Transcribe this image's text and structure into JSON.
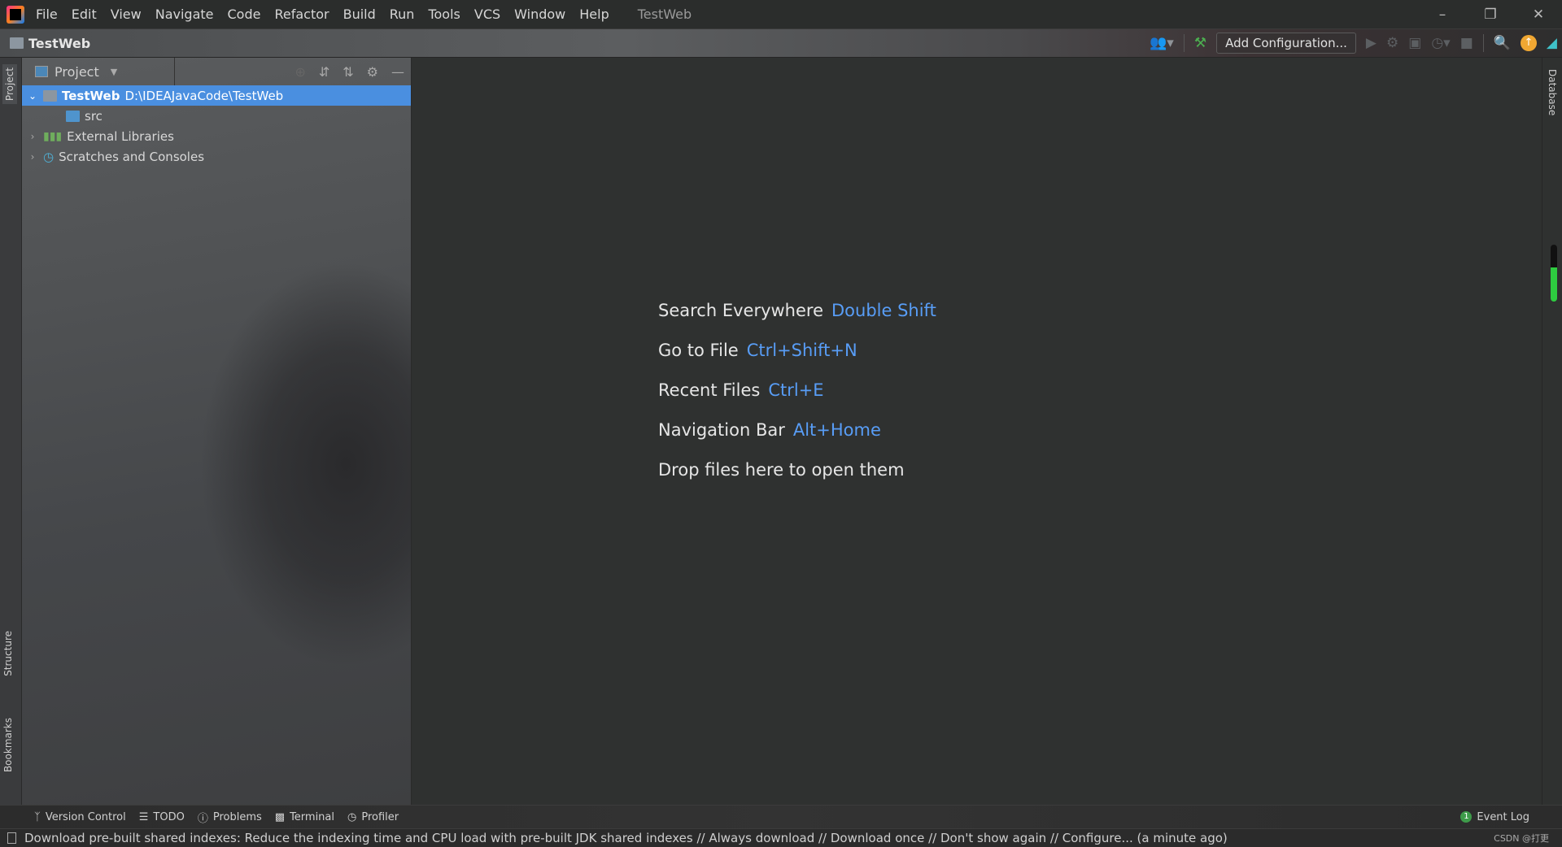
{
  "menubar": {
    "items": [
      "File",
      "Edit",
      "View",
      "Navigate",
      "Code",
      "Refactor",
      "Build",
      "Run",
      "Tools",
      "VCS",
      "Window",
      "Help"
    ],
    "title": "TestWeb"
  },
  "navbar": {
    "project": "TestWeb",
    "add_configuration": "Add Configuration..."
  },
  "left_stripe": {
    "project": "Project",
    "structure": "Structure",
    "bookmarks": "Bookmarks"
  },
  "right_stripe": {
    "database": "Database"
  },
  "project_panel": {
    "title": "Project",
    "tree": [
      {
        "name": "TestWeb",
        "path": "D:\\IDEAJavaCode\\TestWeb",
        "expanded": true,
        "selected": true
      },
      {
        "name": "src"
      },
      {
        "name": "External Libraries"
      },
      {
        "name": "Scratches and Consoles"
      }
    ]
  },
  "welcome": [
    {
      "label": "Search Everywhere",
      "shortcut": "Double Shift"
    },
    {
      "label": "Go to File",
      "shortcut": "Ctrl+Shift+N"
    },
    {
      "label": "Recent Files",
      "shortcut": "Ctrl+E"
    },
    {
      "label": "Navigation Bar",
      "shortcut": "Alt+Home"
    },
    {
      "label": "Drop files here to open them",
      "shortcut": ""
    }
  ],
  "toolwindows": [
    "Version Control",
    "TODO",
    "Problems",
    "Terminal",
    "Profiler"
  ],
  "event_log": {
    "label": "Event Log",
    "count": "1"
  },
  "status": {
    "message": "Download pre-built shared indexes: Reduce the indexing time and CPU load with pre-built JDK shared indexes // Always download // Download once // Don't show again // Configure... (a minute ago)",
    "watermark": "CSDN @打更"
  },
  "colors": {
    "accent": "#589df6",
    "selection": "#4a8fe0"
  }
}
